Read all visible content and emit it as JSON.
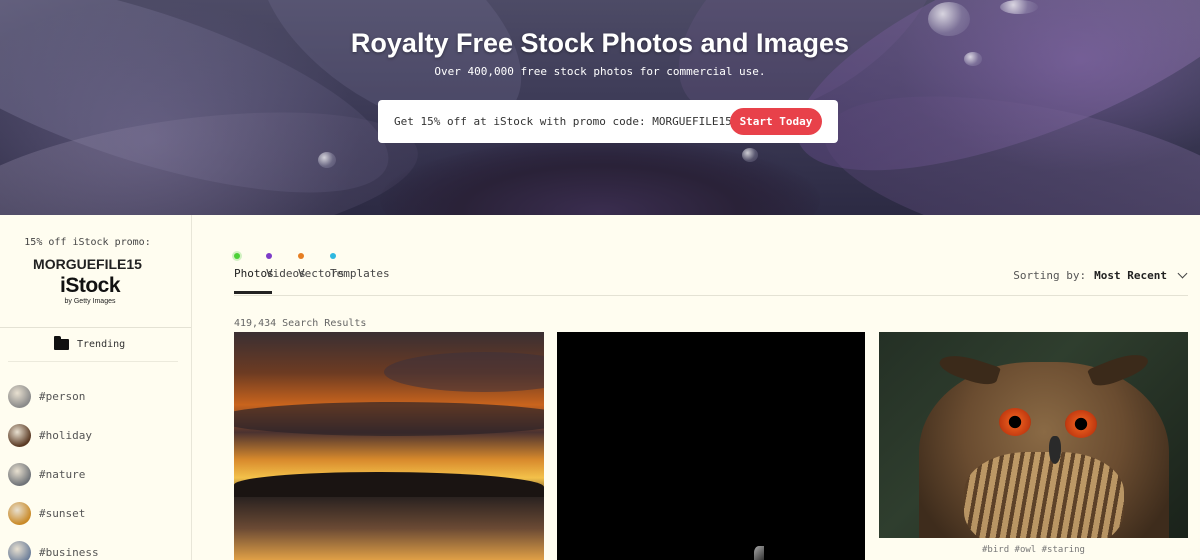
{
  "hero": {
    "title": "Royalty Free Stock Photos and Images",
    "subtitle": "Over 400,000 free stock photos for commercial use.",
    "promo_text": "Get 15% off at iStock with promo code: MORGUEFILE15",
    "promo_button": "Start Today"
  },
  "sidebar": {
    "promo_label": "15% off iStock promo:",
    "promo_code": "MORGUEFILE15",
    "logo_name": "iStock",
    "logo_sub": "by Getty Images",
    "trending_label": "Trending",
    "tags": [
      {
        "label": "#person",
        "color": "#8a8a8a"
      },
      {
        "label": "#holiday",
        "color": "#5a3a24"
      },
      {
        "label": "#nature",
        "color": "#6f7378"
      },
      {
        "label": "#sunset",
        "color": "#c98a28"
      },
      {
        "label": "#business",
        "color": "#6d7f9a"
      }
    ]
  },
  "tabs": [
    {
      "label": "Photos",
      "dot_color": "#4cd137",
      "active": true
    },
    {
      "label": "Videos",
      "dot_color": "#7d3cc8",
      "active": false
    },
    {
      "label": "Vectors",
      "dot_color": "#e67e22",
      "active": false
    },
    {
      "label": "Templates",
      "dot_color": "#2fb8e0",
      "active": false
    }
  ],
  "sorting": {
    "label": "Sorting by:",
    "value": "Most Recent"
  },
  "results": "419,434 Search Results",
  "photos": [
    {
      "tags": ""
    },
    {
      "tags": ""
    },
    {
      "tags": "#bird #owl #staring"
    }
  ]
}
